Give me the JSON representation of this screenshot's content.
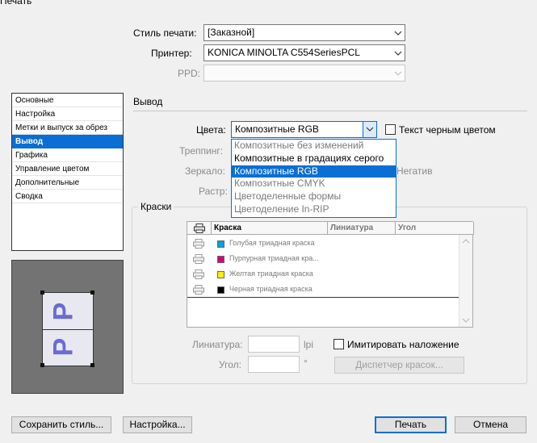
{
  "window": {
    "title": "Печать"
  },
  "header": {
    "print_style_label": "Стиль печати:",
    "print_style_value": "[Заказной]",
    "printer_label": "Принтер:",
    "printer_value": "KONICA MINOLTA C554SeriesPCL",
    "ppd_label": "PPD:",
    "ppd_value": ""
  },
  "sidebar": {
    "items": [
      {
        "label": "Основные"
      },
      {
        "label": "Настройка"
      },
      {
        "label": "Метки и выпуск за обрез"
      },
      {
        "label": "Вывод",
        "selected": true
      },
      {
        "label": "Графика"
      },
      {
        "label": "Управление цветом"
      },
      {
        "label": "Дополнительные"
      },
      {
        "label": "Сводка"
      }
    ]
  },
  "preview": {
    "glyph": "P"
  },
  "output": {
    "section_title": "Вывод",
    "color_label": "Цвета:",
    "color_value": "Композитные RGB",
    "text_black_label": "Текст черным цветом",
    "trapping_label": "Треппинг:",
    "mirror_label": "Зеркало:",
    "negative_label": "Негатив",
    "screen_label": "Растр:",
    "color_options": [
      {
        "label": "Композитные без изменений",
        "enabled": false
      },
      {
        "label": "Композитные в градациях серого",
        "enabled": true
      },
      {
        "label": "Композитные RGB",
        "enabled": true,
        "selected": true
      },
      {
        "label": "Композитные CMYK",
        "enabled": false
      },
      {
        "label": "Цветоделенные формы",
        "enabled": false
      },
      {
        "label": "Цветоделение In-RIP",
        "enabled": false
      }
    ]
  },
  "inks": {
    "group_title": "Краски",
    "columns": [
      "Краска",
      "Линиатура",
      "Угол"
    ],
    "rows": [
      {
        "name": "Голубая триадная краска",
        "color": "#00a0e0"
      },
      {
        "name": "Пурпурная триадная кра...",
        "color": "#d6007e"
      },
      {
        "name": "Желтая триадная краска",
        "color": "#ffee00"
      },
      {
        "name": "Черная триадная краска",
        "color": "#000000"
      }
    ],
    "frequency_label": "Линиатура:",
    "frequency_unit": "lpi",
    "angle_label": "Угол:",
    "angle_unit": "°",
    "simulate_overprint_label": "Имитировать наложение",
    "ink_manager_label": "Диспетчер красок..."
  },
  "footer": {
    "save_style_label": "Сохранить стиль...",
    "setup_label": "Настройка...",
    "print_label": "Печать",
    "cancel_label": "Отмена"
  },
  "colors": {
    "accent": "#0a6ed4",
    "disabled_text": "#8a8a8a"
  }
}
